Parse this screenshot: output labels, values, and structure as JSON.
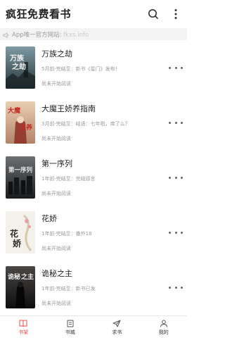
{
  "header": {
    "title": "疯狂免费看书",
    "search_icon": "search-icon",
    "more_icon": "more-vertical-icon"
  },
  "notice": {
    "icon": "megaphone-icon",
    "text": "App唯一官方网站: ",
    "link": "fkxs.info"
  },
  "books": [
    {
      "title": "万族之劫",
      "meta": "5月前·完结至：新书《星门》发布！",
      "status": "尚未开始阅读",
      "cover_text": "万族之劫",
      "cover_colors": [
        "#6f8a93",
        "#2e4046"
      ]
    },
    {
      "title": "大魔王娇养指南",
      "meta": "3月前·完结至：结语：七年啦，痒了么？",
      "status": "尚未开始阅读",
      "cover_text": "大魔王娇养",
      "cover_colors": [
        "#d9b898",
        "#9a3a2c"
      ]
    },
    {
      "title": "第一序列",
      "meta": "1年前·完结至：完结感言",
      "status": "尚未开始阅读",
      "cover_text": "第一序列",
      "cover_colors": [
        "#5a5d60",
        "#1e2022"
      ]
    },
    {
      "title": "花娇",
      "meta": "1年前·完结至：番外18",
      "status": "尚未开始阅读",
      "cover_text": "花娇",
      "cover_colors": [
        "#f4f1ea",
        "#c8b89c"
      ]
    },
    {
      "title": "诡秘之主",
      "meta": "1年前·完结至：新书已发",
      "status": "尚未开始阅读",
      "cover_text": "诡秘之主",
      "cover_colors": [
        "#3d3b3a",
        "#121212"
      ]
    }
  ],
  "tabbar": {
    "active_color": "#e0504f",
    "tabs": [
      {
        "label": "书架",
        "icon": "bookshelf-icon"
      },
      {
        "label": "书城",
        "icon": "bookstore-icon"
      },
      {
        "label": "求书",
        "icon": "send-icon"
      },
      {
        "label": "我的",
        "icon": "profile-icon"
      }
    ]
  }
}
